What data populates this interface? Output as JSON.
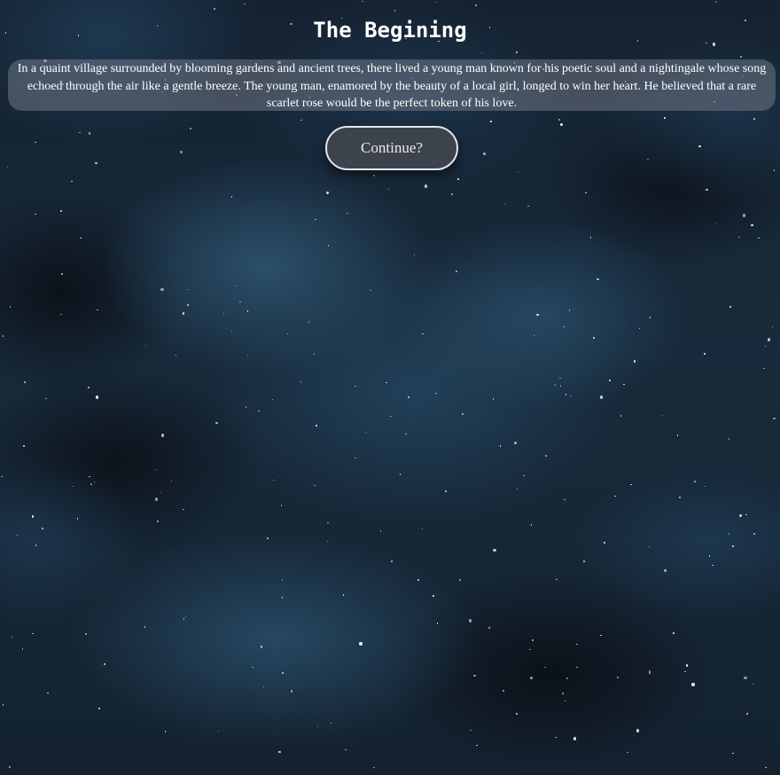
{
  "page": {
    "title": "The Begining",
    "story": "In a quaint village surrounded by blooming gardens and ancient trees, there lived a young man known for his poetic soul and a nightingale whose song echoed through the air like a gentle breeze. The young man, enamored by the beauty of a local girl, longed to win her heart. He believed that a rare scarlet rose would be the perfect token of his love.",
    "continue_label": "Continue?"
  },
  "colors": {
    "sky_dark": "#101822",
    "nebula": "#2c526c",
    "panel": "#808894",
    "button_bg": "#3d434c",
    "button_border": "#e4e7ec",
    "text": "#ffffff"
  }
}
